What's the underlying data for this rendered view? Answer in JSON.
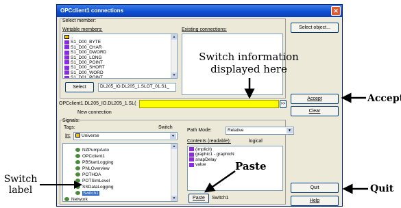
{
  "window": {
    "title": "OPCclient1 connections",
    "close_glyph": "✕"
  },
  "select_member": {
    "group_label": "Select member:",
    "writable_label": "Writable members:",
    "members": [
      "..",
      "S1_D00_BYTE",
      "S1_D00_CHAR",
      "S1_D00_DWORD",
      "S1_D00_LONG",
      "S1_D00_POINT",
      "S1_D00_SHORT",
      "S1_D00_WORD",
      "S1_D01_POINT"
    ],
    "existing_label": "Existing connections:",
    "select_button": "Select",
    "select_path": "DL205_IO.DL205_1.SLOT_01.S1_",
    "select_object_button": "Select object..."
  },
  "connection": {
    "path": "OPCclient1.DL205_IO.DL205_1.SL(",
    "browse_button": ">>",
    "status": "New connection",
    "highlight_color": "#ffff00"
  },
  "buttons": {
    "accept": "Accept",
    "clear": "Clear",
    "quit": "Quit",
    "help": "Help",
    "paste": "Paste"
  },
  "signals": {
    "group_label": "Signals:",
    "tags_label": "Tags:",
    "switch_label": "Switch",
    "in_label": "In:",
    "in_value": "Universe",
    "tree": [
      "NZPumpAuto",
      "OPCclient1",
      "PBStartLogging",
      "PNLOverview",
      "POTHOA",
      "POTSimLevel",
      "SSDataLogging",
      "Switch1",
      "Network"
    ],
    "path_mode_label": "Path Mode:",
    "path_mode_value": "Relative",
    "contents_label": "Contents (readable):",
    "contents_mode": "logical",
    "contents": [
      "(implicit)",
      "graphic1 - graphicN",
      "snapDelay",
      "value"
    ],
    "paste_value": "Switch1"
  },
  "annotations": {
    "switch_info": "Switch information",
    "displayed_here": "displayed here",
    "paste": "Paste",
    "accept": "Accept",
    "quit": "Quit",
    "switch": "Switch",
    "label": "label"
  }
}
